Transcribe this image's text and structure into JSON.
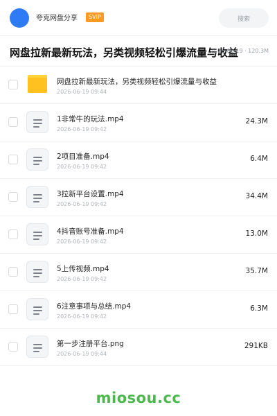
{
  "header": {
    "user_name": "夸克网盘分享",
    "badge": "SVIP",
    "search_placeholder": "搜索"
  },
  "share": {
    "title": "网盘拉新最新玩法，另类视频轻松引爆流量与收益",
    "meta": "2026-06-19 · 120.3M"
  },
  "files": [
    {
      "name": "网盘拉新最新玩法，另类视频轻松引爆流量与收益",
      "date": "2026-06-19 09:44",
      "size": "",
      "icon": "folder-icon"
    },
    {
      "name": "1非常牛的玩法.mp4",
      "date": "2026-06-19 09:42",
      "size": "24.3M",
      "icon": "video-file-icon"
    },
    {
      "name": "2项目准备.mp4",
      "date": "2026-06-19 09:42",
      "size": "6.4M",
      "icon": "video-file-icon"
    },
    {
      "name": "3拉新平台设置.mp4",
      "date": "2026-06-19 09:42",
      "size": "34.4M",
      "icon": "video-file-icon"
    },
    {
      "name": "4抖音账号准备.mp4",
      "date": "2026-06-19 09:42",
      "size": "13.0M",
      "icon": "video-file-icon"
    },
    {
      "name": "5上传视频.mp4",
      "date": "2026-06-19 09:42",
      "size": "35.7M",
      "icon": "video-file-icon"
    },
    {
      "name": "6注意事项与总结.mp4",
      "date": "2026-06-19 09:42",
      "size": "6.3M",
      "icon": "video-file-icon"
    },
    {
      "name": "第一步注册平台.png",
      "date": "2026-06-19 09:44",
      "size": "291KB",
      "icon": "image-file-icon"
    }
  ],
  "watermark": "miosou.cc",
  "colors": {
    "avatar": "#2f7bf5",
    "badge": "#ff9a1f",
    "folder": "#ffc11f",
    "watermark": "#4bb84b"
  }
}
